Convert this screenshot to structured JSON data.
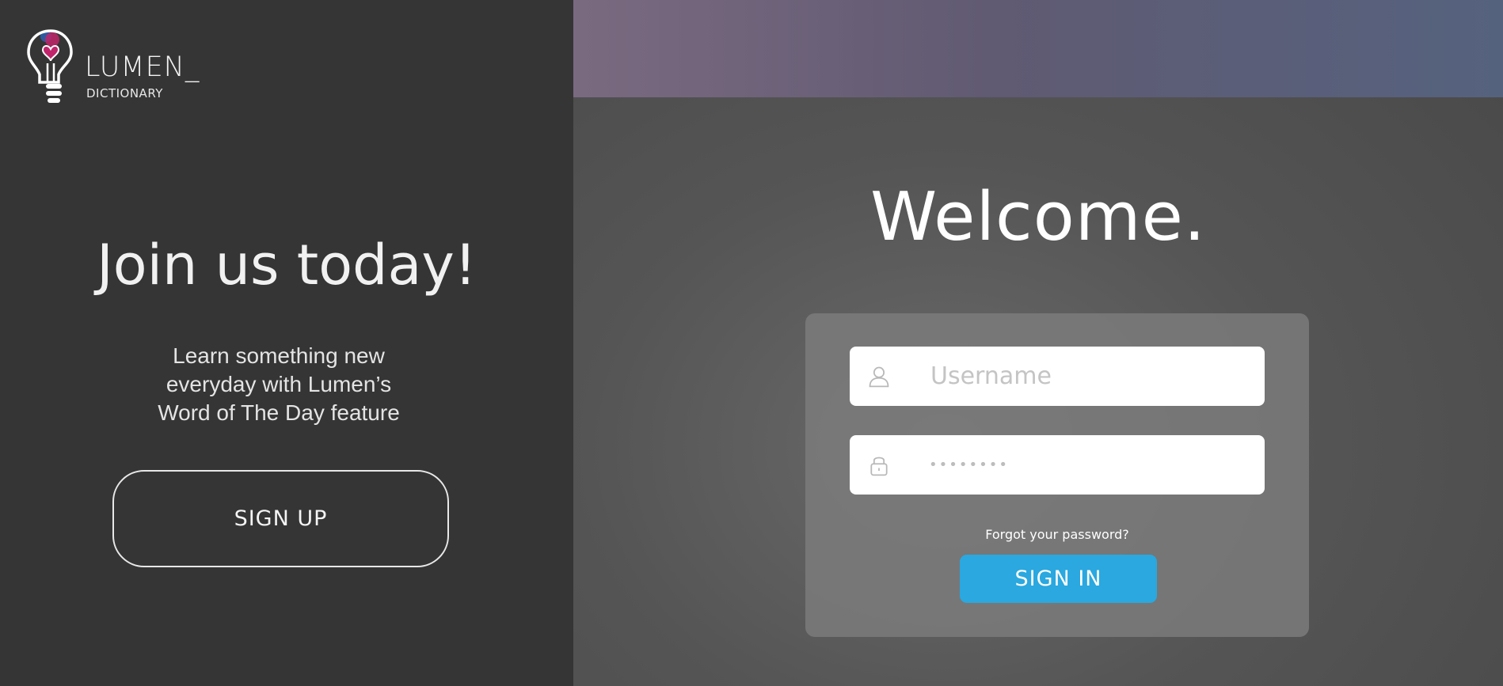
{
  "brand": {
    "name": "LUMEN_",
    "subtitle": "DICTIONARY",
    "logo_icon": "lightbulb-heart-icon"
  },
  "signup_panel": {
    "title": "Join us today!",
    "description_lines": [
      "Learn something new",
      "everyday with Lumen’s",
      "Word of The Day feature"
    ],
    "button_label": "SIGN UP"
  },
  "login_panel": {
    "title": "Welcome.",
    "username": {
      "placeholder": "Username",
      "value": "",
      "icon": "user-icon"
    },
    "password": {
      "masked_value": "••••••••",
      "icon": "lock-icon"
    },
    "forgot_password_label": "Forgot your password?",
    "signin_label": "SIGN IN"
  },
  "colors": {
    "left_background": "#353535",
    "accent_button": "#2aa8df",
    "top_band_start": "#7a6a80",
    "top_band_end": "#55627e",
    "logo_pink": "#c0246a",
    "logo_blue": "#2a5fb0"
  }
}
